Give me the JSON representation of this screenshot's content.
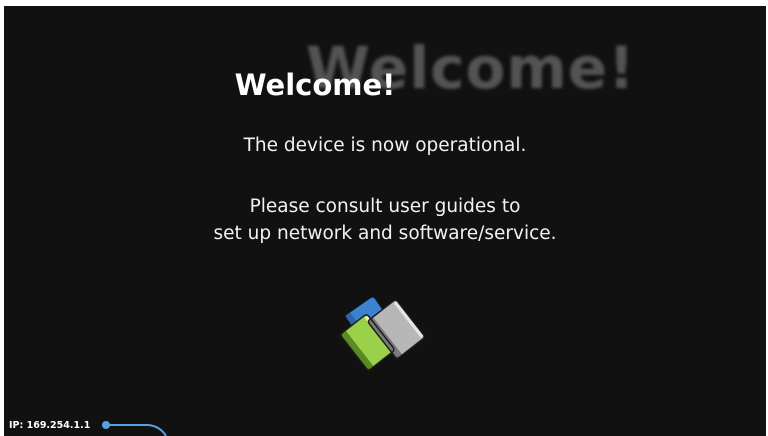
{
  "welcome": {
    "title": "Welcome!",
    "ghost_title": "Welcome!",
    "line1": "The device is now operational.",
    "line2": "Please consult user guides to",
    "line3": "set up network and software/service."
  },
  "status": {
    "ip_text": "IP: 169.254.1.1"
  },
  "icons": {
    "books": "books-icon",
    "pointer": "ip-pointer-icon"
  },
  "colors": {
    "background": "#111111",
    "text": "#ffffff",
    "accent_blue": "#4a90d9",
    "book_green": "#8dc63f",
    "book_gray": "#a8a8a8"
  }
}
